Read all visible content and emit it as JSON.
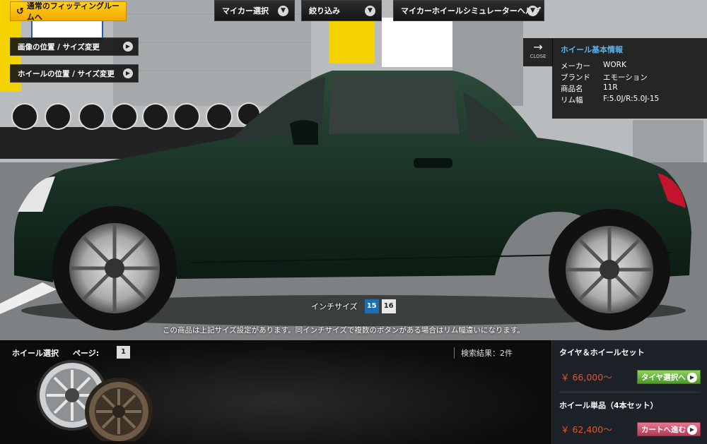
{
  "top_nav": {
    "fitting_room": "通常のフィッティングルームへ",
    "my_car": "マイカー選択",
    "filter": "絞り込み",
    "help": "マイカーホイールシミュレーターヘルプ"
  },
  "side_buttons": {
    "image_pos": "画像の位置 / サイズ変更",
    "wheel_pos": "ホイールの位置 / サイズ変更"
  },
  "info": {
    "close": "CLOSE",
    "title": "ホイール基本情報",
    "rows": [
      {
        "k": "メーカー",
        "v": "WORK"
      },
      {
        "k": "ブランド",
        "v": "エモーション"
      },
      {
        "k": "商品名",
        "v": "11R"
      },
      {
        "k": "リム幅",
        "v": "F:5.0J/R:5.0J-15"
      }
    ]
  },
  "inch": {
    "label": "インチサイズ",
    "sizes": [
      "15",
      "16"
    ],
    "active": "15"
  },
  "notice": "この商品は上記サイズ設定があります。同インチサイズで複数のボタンがある場合はリム幅違いになります。",
  "wheel_panel": {
    "label": "ホイール選択",
    "page_label": "ページ:",
    "page": "1",
    "results": "検索結果：2件"
  },
  "price": {
    "set_title": "タイヤ＆ホイールセット",
    "set_price": "￥ 66,000～",
    "set_button": "タイヤ選択へ",
    "single_title": "ホイール単品（4本セット）",
    "single_price": "￥ 62,400～",
    "single_button": "カートへ進む"
  },
  "colors": {
    "accent_yellow": "#f4b400",
    "info_title_blue": "#5fb3ea",
    "price_red": "#e8532c",
    "car_green": "#1f3a2c"
  }
}
